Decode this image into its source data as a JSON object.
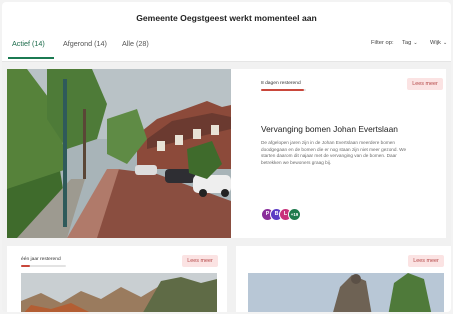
{
  "header": {
    "title": "Gemeente Oegstgeest werkt momenteel aan"
  },
  "tabs": [
    {
      "label": "Actief (14)"
    },
    {
      "label": "Afgerond (14)"
    },
    {
      "label": "Alle (28)"
    }
  ],
  "filters": {
    "filter_label": "Filter op:",
    "tag_label": "Tag",
    "wijk_label": "Wijk"
  },
  "featured": {
    "remaining": "8 dagen resterend",
    "progress": 0.95,
    "button": "Lees meer",
    "title": "Vervanging bomen Johan Evertslaan",
    "description": "De afgelopen jaren zijn in de Johan Evertslaan meerdere bomen doodgegaan en de bomen die er nog staan zijn niet meer gezond. We starten daarom dit najaar met de vervanging van de bomen. Daar betrekken we bewoners graag bij.",
    "avatars": [
      {
        "initial": "P",
        "color": "#8a2d9a"
      },
      {
        "initial": "B",
        "color": "#5b3cc4"
      },
      {
        "initial": "L",
        "color": "#c8327a"
      },
      {
        "initial": "+19",
        "color": "#1f7a4d"
      }
    ]
  },
  "card_left": {
    "remaining": "één jaar resterend",
    "progress": 0.2,
    "button": "Lees meer"
  },
  "card_right": {
    "button": "Lees meer"
  },
  "colors": {
    "accent": "#1b7a52",
    "badge_bg": "#fbe3e3",
    "badge_text": "#b34545",
    "progress": "#c9473b"
  }
}
